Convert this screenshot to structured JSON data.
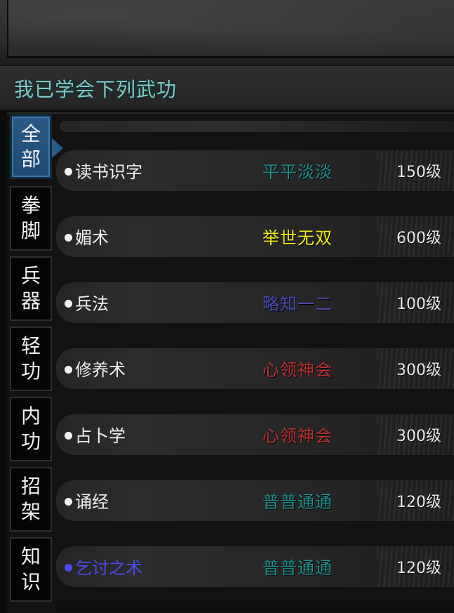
{
  "header": {
    "title": "我已学会下列武功"
  },
  "tabs": [
    {
      "chars": [
        "全",
        "部"
      ],
      "active": true
    },
    {
      "chars": [
        "拳",
        "脚"
      ],
      "active": false
    },
    {
      "chars": [
        "兵",
        "器"
      ],
      "active": false
    },
    {
      "chars": [
        "轻",
        "功"
      ],
      "active": false
    },
    {
      "chars": [
        "内",
        "功"
      ],
      "active": false
    },
    {
      "chars": [
        "招",
        "架"
      ],
      "active": false
    },
    {
      "chars": [
        "知",
        "识"
      ],
      "active": false
    }
  ],
  "skills": [
    {
      "name": "读书识字",
      "rank": "平平淡淡",
      "rank_color": "#1f8f8f",
      "level": "150级",
      "name_color": "#f0f0f0"
    },
    {
      "name": "媚术",
      "rank": "举世无双",
      "rank_color": "#f2ee1a",
      "level": "600级",
      "name_color": "#f0f0f0"
    },
    {
      "name": "兵法",
      "rank": "略知一二",
      "rank_color": "#4a4ab0",
      "level": "100级",
      "name_color": "#f0f0f0"
    },
    {
      "name": "修养术",
      "rank": "心领神会",
      "rank_color": "#b83030",
      "level": "300级",
      "name_color": "#f0f0f0"
    },
    {
      "name": "占卜学",
      "rank": "心领神会",
      "rank_color": "#b83030",
      "level": "300级",
      "name_color": "#f0f0f0"
    },
    {
      "name": "诵经",
      "rank": "普普通通",
      "rank_color": "#1f8f8f",
      "level": "120级",
      "name_color": "#f0f0f0"
    },
    {
      "name": "乞讨之术",
      "rank": "普普通通",
      "rank_color": "#1f8f8f",
      "level": "120级",
      "name_color": "#4b4bf0"
    }
  ]
}
